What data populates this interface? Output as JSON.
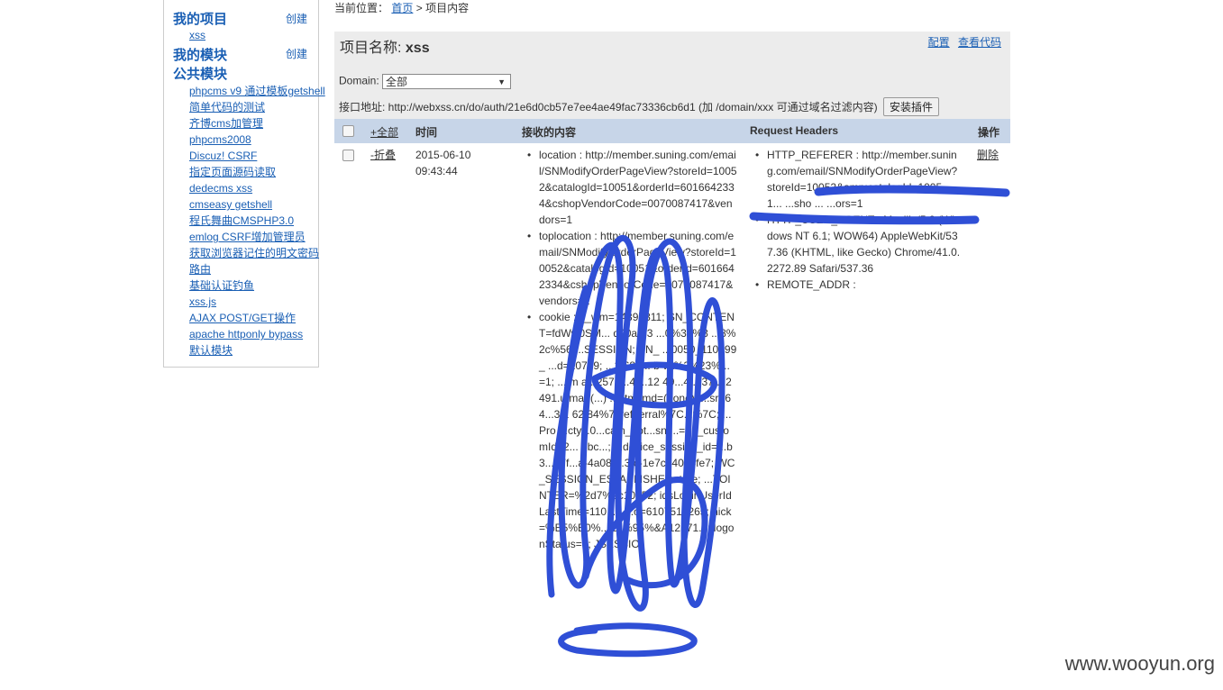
{
  "sidebar": {
    "my_projects": {
      "title": "我的项目",
      "create": "创建",
      "items": [
        "xss"
      ]
    },
    "my_modules": {
      "title": "我的模块",
      "create": "创建"
    },
    "public_modules": {
      "title": "公共模块",
      "items": [
        "phpcms v9 通过模板getshell",
        "简单代码的测试",
        "齐博cms加管理",
        "phpcms2008",
        "Discuz! CSRF",
        "指定页面源码读取",
        "dedecms xss",
        "cmseasy getshell",
        "程氏舞曲CMSPHP3.0",
        "emlog CSRF增加管理员",
        "获取浏览器记住的明文密码",
        "路由",
        "基础认证钓鱼",
        "xss.js",
        "AJAX POST/GET操作",
        "apache httponly bypass",
        "默认模块"
      ]
    }
  },
  "breadcrumb": {
    "prefix": "当前位置：",
    "home": "首页",
    "sep": ">",
    "current": "项目内容"
  },
  "project": {
    "label": "项目名称:",
    "name": "xss",
    "links": {
      "config": "配置",
      "view_code": "查看代码"
    },
    "domain_label": "Domain:",
    "domain_value": "全部",
    "api_prefix": "接口地址: http://webxss.cn/do/auth/21e6d0cb57e7ee4ae49fac73336cb6d1 (加 /domain/xxx 可通过域名过滤内容)",
    "install_button": "安装插件"
  },
  "table": {
    "headers": {
      "expand_all": "+全部",
      "time": "时间",
      "content": "接收的内容",
      "request_headers": "Request Headers",
      "actions": "操作"
    },
    "rows": [
      {
        "toggle": "-折叠",
        "time": "2015-06-10 09:43:44",
        "content": [
          "location : http://member.suning.com/email/SNModifyOrderPageView?storeId=10052&catalogId=10051&orderId=6016642334&cshopVendorCode=0070087417&vendors=1",
          "toplocation : http://member.suning.com/email/SNModifyOrderPageView?storeId=10052&catalogId=10051&orderId=6016642334&cshopVendorCode=0070087417&vendors=1",
          "cookie : __wm=14397311; SN_CONTENT=fdWw0SM... d90a%3 ...0%3a%3 ...8%2c%56 ...SESSION; SN_ ...0050_110399_ ...d=10739; ...2.68; ... b va%3%23%... =1; ... m a...2572...4 ...12 49...4 ...37 ...2 491.utma=(...) ...utmcmd=(none); ...sr=64...3.1 62.84%7cref..erral%7C...%7C; ...Pro ...cty...0...cam_abt...snt...=6; _customId=2... 3bc...; ...device_session_id=...b3...27f...a-4a08-...3fc-1e7cd4068fe7; WC_SESSION_ESTABLISHED=true; ...TOINTER=%2d7%2c10052; idsLoginUserIdLastTime=110 ...; ...o=6107512265; nick=%E5%B0%...E5%95%&A12571...; logonStatus=0; JSESSIO"
        ],
        "headers": [
          "HTTP_REFERER : http://member.suning.com/email/SNModifyOrderPageView?storeId=10052&amp;catalogId=1005 ... 1... ...sho ... ...ors=1",
          "HTTP_USER_AGENT : Mozilla/5.0 (Windows NT 6.1; WOW64) AppleWebKit/537.36 (KHTML, like Gecko) Chrome/41.0.2272.89 Safari/537.36",
          "REMOTE_ADDR :"
        ],
        "delete": "删除"
      }
    ]
  },
  "watermark": "www.wooyun.org",
  "colors": {
    "link": "#1a5fb4",
    "header_bg": "#c7d5e8",
    "panel_bg": "#ececec",
    "scribble": "#2f4fd6"
  }
}
